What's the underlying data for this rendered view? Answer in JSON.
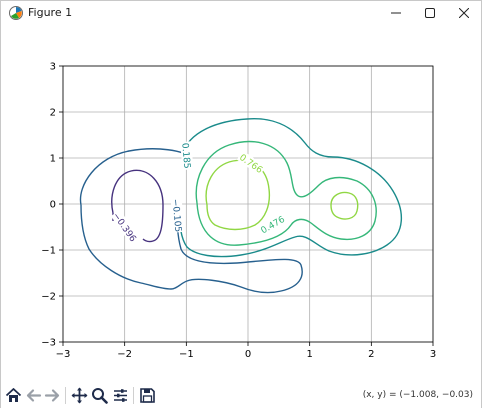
{
  "window": {
    "title": "Figure 1",
    "app_icon": "matplotlib-icon",
    "controls": [
      "minimize-icon",
      "maximize-icon",
      "close-icon"
    ]
  },
  "toolbar": {
    "buttons": [
      "home-icon",
      "back-arrow-icon",
      "forward-arrow-icon",
      "pan-icon",
      "zoom-icon",
      "configure-subplots-icon",
      "save-icon"
    ],
    "coords_readout": "(x, y) = (−1.008, −0.03)"
  },
  "chart_data": {
    "type": "contour",
    "title": "",
    "xlabel": "",
    "ylabel": "",
    "xlim": [
      -3,
      3
    ],
    "ylim": [
      -3,
      3
    ],
    "x_ticks": [
      "−3",
      "−2",
      "−1",
      "0",
      "1",
      "2",
      "3"
    ],
    "y_ticks": [
      "−3",
      "−2",
      "−1",
      "0",
      "1",
      "2",
      "3"
    ],
    "grid": true,
    "colormap": "viridis",
    "contour_labels": [
      {
        "text": "−0.396",
        "x": -2.0,
        "y": -0.5,
        "color": "#46327e"
      },
      {
        "text": "−0.105",
        "x": -1.15,
        "y": -0.25,
        "color": "#27608e"
      },
      {
        "text": "0.185",
        "x": -1.0,
        "y": 1.05,
        "color": "#1a8b8b"
      },
      {
        "text": "0.476",
        "x": 0.4,
        "y": -0.45,
        "color": "#35b779"
      },
      {
        "text": "0.766",
        "x": 0.05,
        "y": 0.88,
        "color": "#90d743"
      }
    ],
    "levels": [
      {
        "value": -0.396,
        "color": "#46327e"
      },
      {
        "value": -0.105,
        "color": "#27608e"
      },
      {
        "value": 0.185,
        "color": "#1a8b8b"
      },
      {
        "value": 0.476,
        "color": "#35b779"
      },
      {
        "value": 0.766,
        "color": "#90d743"
      }
    ]
  }
}
